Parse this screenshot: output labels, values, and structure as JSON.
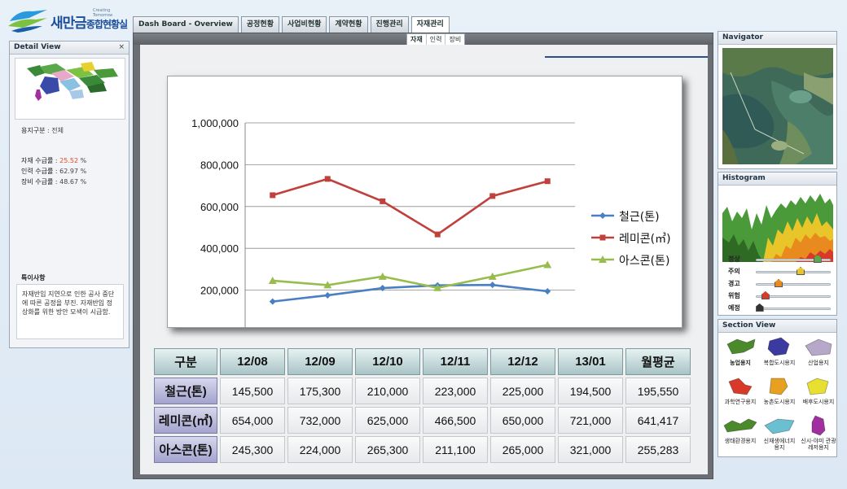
{
  "app": {
    "logo_text": "새만금",
    "logo_sub": "종합현황실",
    "logo_tagline": "Creating Tomorrow"
  },
  "tabs": [
    {
      "label": "Dash Board - Overview"
    },
    {
      "label": "공정현황"
    },
    {
      "label": "사업비현황"
    },
    {
      "label": "계약현황"
    },
    {
      "label": "진행관리"
    },
    {
      "label": "자재관리"
    }
  ],
  "subtabs": [
    {
      "label": "자재"
    },
    {
      "label": "인력"
    },
    {
      "label": "장비"
    }
  ],
  "detail": {
    "title": "Detail View",
    "close": "×",
    "area_label": "용지구분",
    "area_value": ": 전체",
    "material_label": "자재 수급률",
    "material_value": "25.52",
    "labor_label": "인력 수급률",
    "labor_value": ": 62.97 %",
    "equip_label": "장비 수급률",
    "equip_value": ": 48.67 %",
    "notes_title": "특이사항",
    "notes_text": "자재반입 지연으로 인한 공사 중단에 따른 공정을 부진. 자재반입 정상화를 위한 방안 모색이 시급함."
  },
  "chart_data": {
    "type": "line",
    "categories": [
      "12/08",
      "12/09",
      "12/10",
      "12/11",
      "12/12",
      "13/01"
    ],
    "series": [
      {
        "name": "철근(톤)",
        "color": "#4a7fc4",
        "marker": "diamond",
        "values": [
          145500,
          175300,
          210000,
          223000,
          225000,
          194500
        ]
      },
      {
        "name": "레미콘(㎥)",
        "color": "#c0403c",
        "marker": "square",
        "values": [
          654000,
          732000,
          625000,
          466500,
          650000,
          721000
        ]
      },
      {
        "name": "아스콘(톤)",
        "color": "#98bd4e",
        "marker": "triangle",
        "values": [
          245300,
          224000,
          265300,
          211100,
          265000,
          321000
        ]
      }
    ],
    "y_ticks": [
      "-",
      "200,000",
      "400,000",
      "600,000",
      "800,000",
      "1,000,000"
    ],
    "ylim": [
      0,
      1000000
    ],
    "grid": true,
    "legend": "right"
  },
  "table": {
    "corner": "구분",
    "headers": [
      "12/08",
      "12/09",
      "12/10",
      "12/11",
      "12/12",
      "13/01",
      "월평균"
    ],
    "rows": [
      {
        "label": "철근(톤)",
        "cells": [
          "145,500",
          "175,300",
          "210,000",
          "223,000",
          "225,000",
          "194,500",
          "195,550"
        ]
      },
      {
        "label": "레미콘(㎥)",
        "cells": [
          "654,000",
          "732,000",
          "625,000",
          "466,500",
          "650,000",
          "721,000",
          "641,417"
        ]
      },
      {
        "label": "아스콘(톤)",
        "cells": [
          "245,300",
          "224,000",
          "265,300",
          "211,100",
          "265,000",
          "321,000",
          "255,283"
        ]
      }
    ]
  },
  "navigator": {
    "title": "Navigator"
  },
  "histogram": {
    "title": "Histogram",
    "levels": [
      {
        "label": "정상",
        "value": 0.83,
        "color": "#5aa84a"
      },
      {
        "label": "주의",
        "value": 0.6,
        "color": "#e8c62a"
      },
      {
        "label": "경고",
        "value": 0.3,
        "color": "#e88a1e"
      },
      {
        "label": "위험",
        "value": 0.12,
        "color": "#d83a2a"
      },
      {
        "label": "예정",
        "value": 0.04,
        "color": "#333333"
      }
    ]
  },
  "section_view": {
    "title": "Section View",
    "items": [
      {
        "label": "농업용지",
        "icon": "farmland-icon",
        "color": "#4a8a2a",
        "bold": true
      },
      {
        "label": "복합도시용지",
        "icon": "complex-city-icon",
        "color": "#3a3aa0",
        "bold": false
      },
      {
        "label": "산업용지",
        "icon": "industrial-icon",
        "color": "#b7a7c8",
        "bold": false
      },
      {
        "label": "과학연구용지",
        "icon": "science-icon",
        "color": "#d83a2a",
        "bold": false
      },
      {
        "label": "농촌도시용지",
        "icon": "rural-city-icon",
        "color": "#e8a020",
        "bold": false
      },
      {
        "label": "배후도시용지",
        "icon": "hinterland-icon",
        "color": "#e8e030",
        "bold": false
      },
      {
        "label": "생태환경용지",
        "icon": "ecology-icon",
        "color": "#4a8a2a",
        "bold": false
      },
      {
        "label": "신재생에너지 용지",
        "icon": "renewable-icon",
        "color": "#6ac0d0",
        "bold": false
      },
      {
        "label": "신시-야미 관광레저용지",
        "icon": "tourism-icon",
        "color": "#a030a0",
        "bold": false
      }
    ]
  }
}
